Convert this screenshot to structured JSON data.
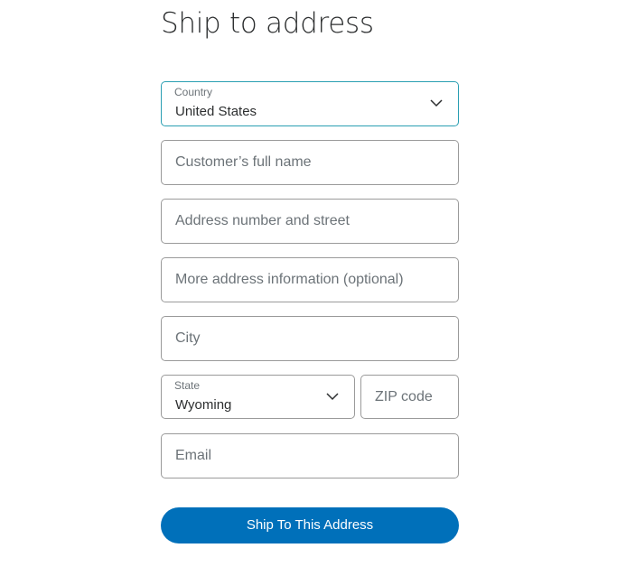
{
  "page": {
    "title": "Ship to address"
  },
  "form": {
    "country": {
      "label": "Country",
      "value": "United States"
    },
    "full_name": {
      "placeholder": "Customer’s full name"
    },
    "address1": {
      "placeholder": "Address number and street"
    },
    "address2": {
      "placeholder": "More address information (optional)"
    },
    "city": {
      "placeholder": "City"
    },
    "state": {
      "label": "State",
      "value": "Wyoming"
    },
    "zip": {
      "placeholder": "ZIP code"
    },
    "email": {
      "placeholder": "Email"
    },
    "submit_label": "Ship To This Address"
  },
  "colors": {
    "accent": "#0070ba",
    "focus_border": "#2a9fb3"
  }
}
